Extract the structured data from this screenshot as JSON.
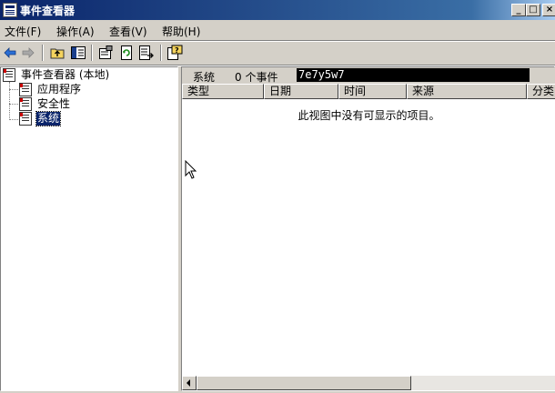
{
  "window": {
    "title": "事件查看器",
    "min_label": "_",
    "max_label": "□",
    "close_label": "×"
  },
  "menu": {
    "items": [
      {
        "label": "文件(F)"
      },
      {
        "label": "操作(A)"
      },
      {
        "label": "查看(V)"
      },
      {
        "label": "帮助(H)"
      }
    ]
  },
  "toolbar": {
    "icons": [
      "back-arrow-icon",
      "forward-arrow-icon",
      "up-folder-icon",
      "show-tree-icon",
      "properties-icon",
      "refresh-icon",
      "export-list-icon",
      "help-icon"
    ]
  },
  "tree": {
    "root": "事件查看器 (本地)",
    "children": [
      {
        "label": "应用程序"
      },
      {
        "label": "安全性"
      },
      {
        "label": "系统",
        "selected": true
      }
    ]
  },
  "details": {
    "log_name": "系统",
    "event_count": "0 个事件",
    "highlight_text": "7e7y5w7",
    "columns": [
      "类型",
      "日期",
      "时间",
      "来源",
      "分类"
    ],
    "empty_message": "此视图中没有可显示的项目。"
  }
}
